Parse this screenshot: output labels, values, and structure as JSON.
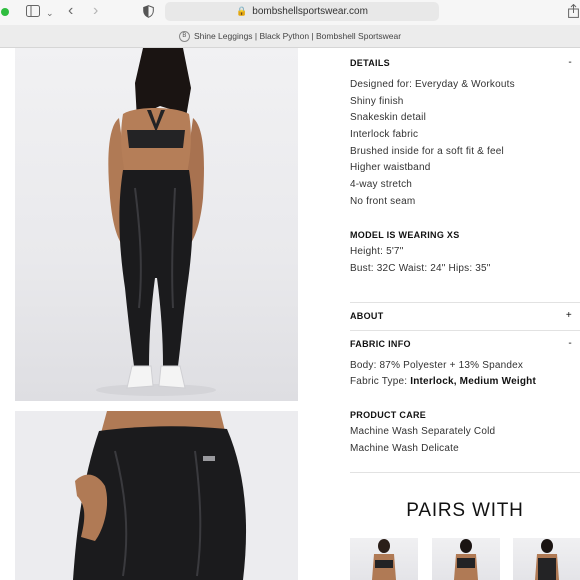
{
  "browser": {
    "url": "bombshellsportswear.com",
    "tab_title": "Shine Leggings | Black Python | Bombshell Sportswear"
  },
  "details": {
    "heading": "DETAILS",
    "toggle": "-",
    "items": [
      "Designed for: Everyday & Workouts",
      "Shiny finish",
      "Snakeskin detail",
      "Interlock fabric",
      "Brushed inside for a soft fit & feel",
      "Higher waistband",
      "4-way stretch",
      "No front seam"
    ]
  },
  "model": {
    "heading": "MODEL IS WEARING XS",
    "height": "Height: 5'7\"",
    "measurements": "Bust: 32C Waist: 24\" Hips: 35\""
  },
  "about": {
    "heading": "ABOUT",
    "toggle": "+"
  },
  "fabric": {
    "heading": "FABRIC INFO",
    "toggle": "-",
    "body": "Body: 87% Polyester + 13% Spandex",
    "type_label": "Fabric Type:",
    "type_value": "Interlock, Medium Weight"
  },
  "care": {
    "heading": "PRODUCT CARE",
    "items": [
      "Machine Wash Separately Cold",
      "Machine Wash Delicate"
    ]
  },
  "pairs": {
    "heading": "PAIRS WITH"
  },
  "colors": {
    "legging": "#1b1b1d",
    "skin": "#b07a55",
    "bra": "#232325",
    "sneaker": "#f4f4f4"
  }
}
